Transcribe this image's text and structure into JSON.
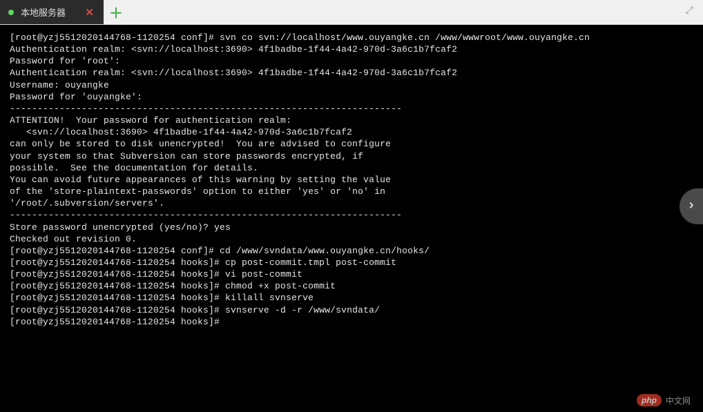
{
  "tabbar": {
    "active_tab_label": "本地服务器",
    "close_glyph": "✕",
    "add_glyph": "＋"
  },
  "fullscreen_icon_glyph": "⤢",
  "nav_arrow_glyph": "›",
  "watermark": {
    "badge": "php",
    "text": "中文网"
  },
  "terminal": {
    "lines": [
      "[root@yzj5512020144768-1120254 conf]# svn co svn://localhost/www.ouyangke.cn /www/wwwroot/www.ouyangke.cn",
      "Authentication realm: <svn://localhost:3690> 4f1badbe-1f44-4a42-970d-3a6c1b7fcaf2",
      "Password for 'root':",
      "Authentication realm: <svn://localhost:3690> 4f1badbe-1f44-4a42-970d-3a6c1b7fcaf2",
      "Username: ouyangke",
      "Password for 'ouyangke':",
      "",
      "-----------------------------------------------------------------------",
      "ATTENTION!  Your password for authentication realm:",
      "",
      "   <svn://localhost:3690> 4f1badbe-1f44-4a42-970d-3a6c1b7fcaf2",
      "",
      "can only be stored to disk unencrypted!  You are advised to configure",
      "your system so that Subversion can store passwords encrypted, if",
      "possible.  See the documentation for details.",
      "",
      "You can avoid future appearances of this warning by setting the value",
      "of the 'store-plaintext-passwords' option to either 'yes' or 'no' in",
      "'/root/.subversion/servers'.",
      "-----------------------------------------------------------------------",
      "Store password unencrypted (yes/no)? yes",
      "Checked out revision 0.",
      "[root@yzj5512020144768-1120254 conf]# cd /www/svndata/www.ouyangke.cn/hooks/",
      "[root@yzj5512020144768-1120254 hooks]# cp post-commit.tmpl post-commit",
      "[root@yzj5512020144768-1120254 hooks]# vi post-commit",
      "[root@yzj5512020144768-1120254 hooks]# chmod +x post-commit",
      "[root@yzj5512020144768-1120254 hooks]# killall svnserve",
      "[root@yzj5512020144768-1120254 hooks]# svnserve -d -r /www/svndata/",
      "[root@yzj5512020144768-1120254 hooks]# "
    ]
  }
}
